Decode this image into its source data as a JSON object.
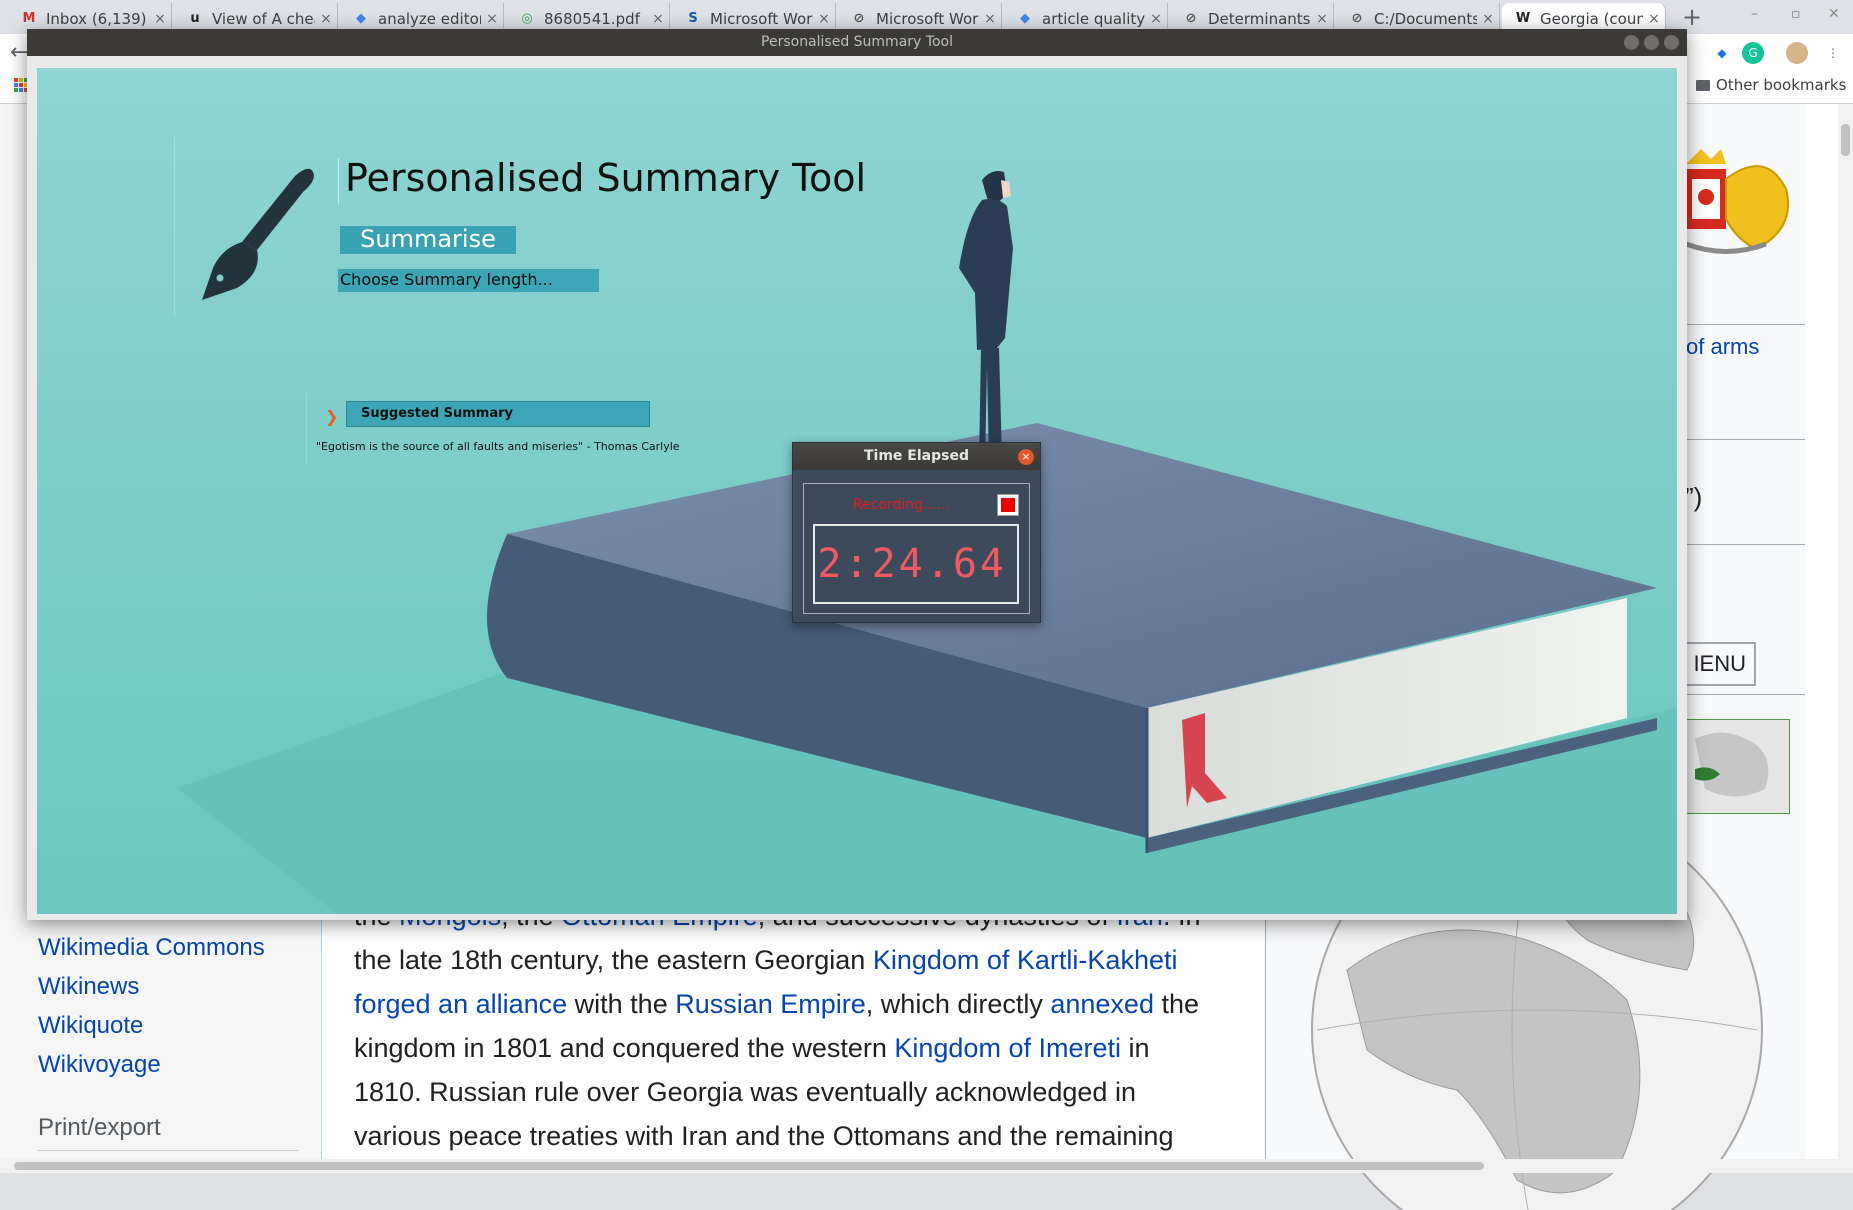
{
  "browser": {
    "tabs": [
      {
        "title": "Inbox (6,139) - ",
        "icon": "gmail-icon"
      },
      {
        "title": "View of A chea",
        "icon": "u-icon"
      },
      {
        "title": "analyze editor",
        "icon": "drive-icon"
      },
      {
        "title": "8680541.pdf",
        "icon": "pdf-viewer-icon"
      },
      {
        "title": "Microsoft Wor",
        "icon": "semantic-scholar-icon"
      },
      {
        "title": "Microsoft Wor",
        "icon": "link-icon"
      },
      {
        "title": "article quality",
        "icon": "drive-icon"
      },
      {
        "title": "Determinants",
        "icon": "link-icon"
      },
      {
        "title": "C:/Documents",
        "icon": "link-icon"
      },
      {
        "title": "Georgia (coun",
        "icon": "wikipedia-icon",
        "active": true
      }
    ],
    "other_bookmarks": "Other bookmarks"
  },
  "wiki": {
    "sidebar_links": [
      "Wikimedia Commons",
      "Wikinews",
      "Wikiquote",
      "Wikivoyage"
    ],
    "sidebar_heading": "Print/export",
    "infobox_coa_label": "of arms",
    "infobox_quote_fragment": "”)",
    "menu_button": "IENU",
    "article_lines": [
      [
        {
          "t": "the "
        },
        {
          "t": "Mongols",
          "link": true
        },
        {
          "t": ", the "
        },
        {
          "t": "Ottoman Empire",
          "link": true
        },
        {
          "t": ", and successive dynasties of "
        },
        {
          "t": "Iran",
          "link": true
        },
        {
          "t": ". In"
        }
      ],
      [
        {
          "t": "the late 18th century, the eastern Georgian "
        },
        {
          "t": "Kingdom of Kartli-Kakheti",
          "link": true
        }
      ],
      [
        {
          "t": "forged an alliance",
          "link": true
        },
        {
          "t": " with the "
        },
        {
          "t": "Russian Empire",
          "link": true
        },
        {
          "t": ", which directly "
        },
        {
          "t": "annexed",
          "link": true
        },
        {
          "t": " the"
        }
      ],
      [
        {
          "t": "kingdom in 1801 and conquered the western "
        },
        {
          "t": "Kingdom of Imereti",
          "link": true
        },
        {
          "t": " in"
        }
      ],
      [
        {
          "t": "1810. Russian rule over Georgia was eventually acknowledged in"
        }
      ],
      [
        {
          "t": "various peace treaties with Iran and the Ottomans and the remaining"
        }
      ]
    ]
  },
  "tool": {
    "window_title": "Personalised Summary Tool",
    "heading": "Personalised Summary Tool",
    "summarise_button": "Summarise",
    "summary_length_placeholder": "Choose Summary length...",
    "suggested_header": "Suggested Summary",
    "quote": "\"Egotism is the source of all faults and miseries\" - Thomas Carlyle",
    "colors": {
      "background": "#7ecfcb",
      "accent": "#3ca6b6",
      "book": "#4b6180"
    }
  },
  "timer": {
    "title": "Time Elapsed",
    "status": "Recording......",
    "elapsed": "2:24.64",
    "colors": {
      "stop": "#ee0000",
      "digits": "#f25a62"
    }
  }
}
